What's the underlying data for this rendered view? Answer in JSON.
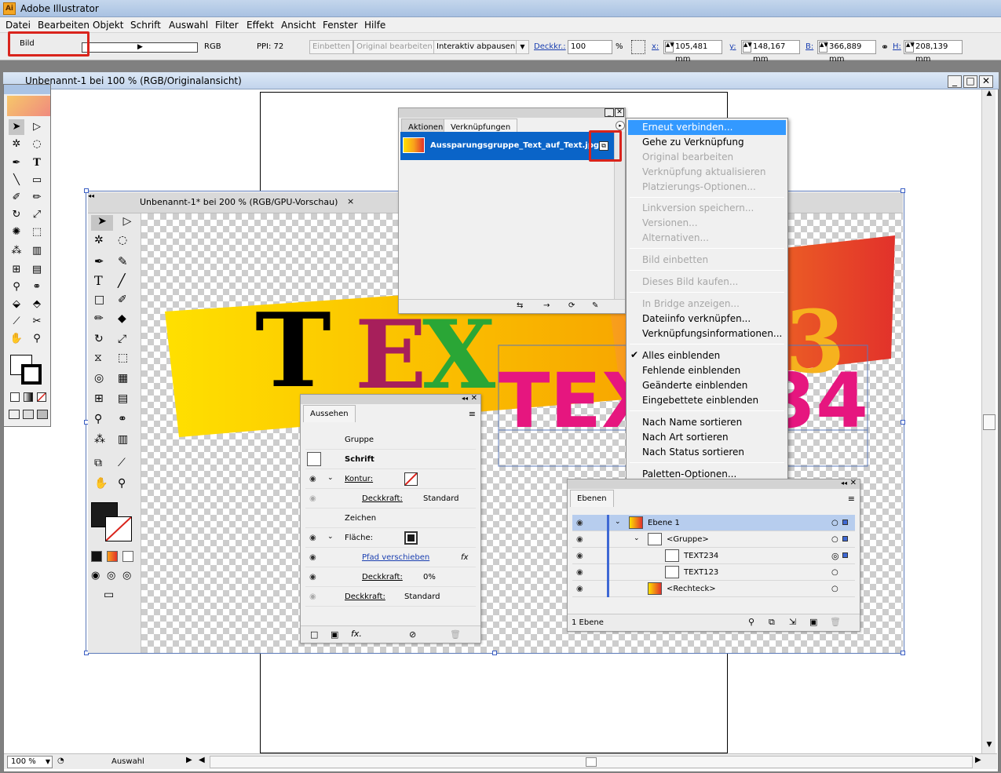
{
  "app": {
    "title": "Adobe Illustrator"
  },
  "menu": [
    "Datei",
    "Bearbeiten",
    "Objekt",
    "Schrift",
    "Auswahl",
    "Filter",
    "Effekt",
    "Ansicht",
    "Fenster",
    "Hilfe"
  ],
  "control": {
    "object_type": "Bild",
    "color_mode": "RGB",
    "ppi": "PPI: 72",
    "embed": "Einbetten",
    "edit_original": "Original bearbeiten",
    "live_trace": "Interaktiv abpausen",
    "opacity_label": "Deckkr.:",
    "opacity_value": "100",
    "percent": "%",
    "x_label": "x:",
    "x_value": "105,481 mm",
    "y_label": "y:",
    "y_value": "148,167 mm",
    "w_label": "B:",
    "w_value": "366,889 mm",
    "h_label": "H:",
    "h_value": "208,139 mm"
  },
  "doc1": {
    "title": "Unbenannt-1 bei 100 % (RGB/Originalansicht)"
  },
  "doc2": {
    "tab": "Unbenannt-1* bei 200 % (RGB/GPU-Vorschau)",
    "close": "×"
  },
  "status": {
    "zoom": "100 %",
    "tool": "Auswahl"
  },
  "links_panel": {
    "tab_actions": "Aktionen",
    "tab_links": "Verknüpfungen",
    "file": "Aussparungsgruppe_Text_auf_Text.jpg"
  },
  "context_menu": [
    {
      "label": "Erneut verbinden...",
      "enabled": true,
      "highlight": true
    },
    {
      "label": "Gehe zu Verknüpfung",
      "enabled": true
    },
    {
      "label": "Original bearbeiten",
      "enabled": false
    },
    {
      "label": "Verknüpfung aktualisieren",
      "enabled": false
    },
    {
      "label": "Platzierungs-Optionen...",
      "enabled": false
    },
    {
      "sep": true
    },
    {
      "label": "Linkversion speichern...",
      "enabled": false
    },
    {
      "label": "Versionen...",
      "enabled": false
    },
    {
      "label": "Alternativen...",
      "enabled": false
    },
    {
      "sep": true
    },
    {
      "label": "Bild einbetten",
      "enabled": false
    },
    {
      "sep": true
    },
    {
      "label": "Dieses Bild kaufen...",
      "enabled": false
    },
    {
      "sep": true
    },
    {
      "label": "In Bridge anzeigen...",
      "enabled": false
    },
    {
      "label": "Dateiinfo verknüpfen...",
      "enabled": true
    },
    {
      "label": "Verknüpfungsinformationen...",
      "enabled": true
    },
    {
      "sep": true
    },
    {
      "label": "Alles einblenden",
      "enabled": true,
      "checked": true
    },
    {
      "label": "Fehlende einblenden",
      "enabled": true
    },
    {
      "label": "Geänderte einblenden",
      "enabled": true
    },
    {
      "label": "Eingebettete einblenden",
      "enabled": true
    },
    {
      "sep": true
    },
    {
      "label": "Nach Name sortieren",
      "enabled": true
    },
    {
      "label": "Nach Art sortieren",
      "enabled": true
    },
    {
      "label": "Nach Status sortieren",
      "enabled": true
    },
    {
      "sep": true
    },
    {
      "label": "Paletten-Optionen...",
      "enabled": true
    }
  ],
  "appearance": {
    "title": "Aussehen",
    "group": "Gruppe",
    "text": "Schrift",
    "stroke": "Kontur:",
    "opacity": "Deckkraft:",
    "standard": "Standard",
    "chars": "Zeichen",
    "fill": "Fläche:",
    "offset_path": "Pfad verschieben",
    "fx": "fx",
    "opacity_value": "0%",
    "opacity2": "Deckkraft:",
    "standard2": "Standard"
  },
  "layers": {
    "title": "Ebenen",
    "rows": [
      "Ebene 1",
      "<Gruppe>",
      "TEXT234",
      "TEXT123",
      "<Rechteck>"
    ],
    "count": "1 Ebene"
  },
  "artwork": {
    "text1": "TEXT123",
    "text2": "TEXT234"
  }
}
